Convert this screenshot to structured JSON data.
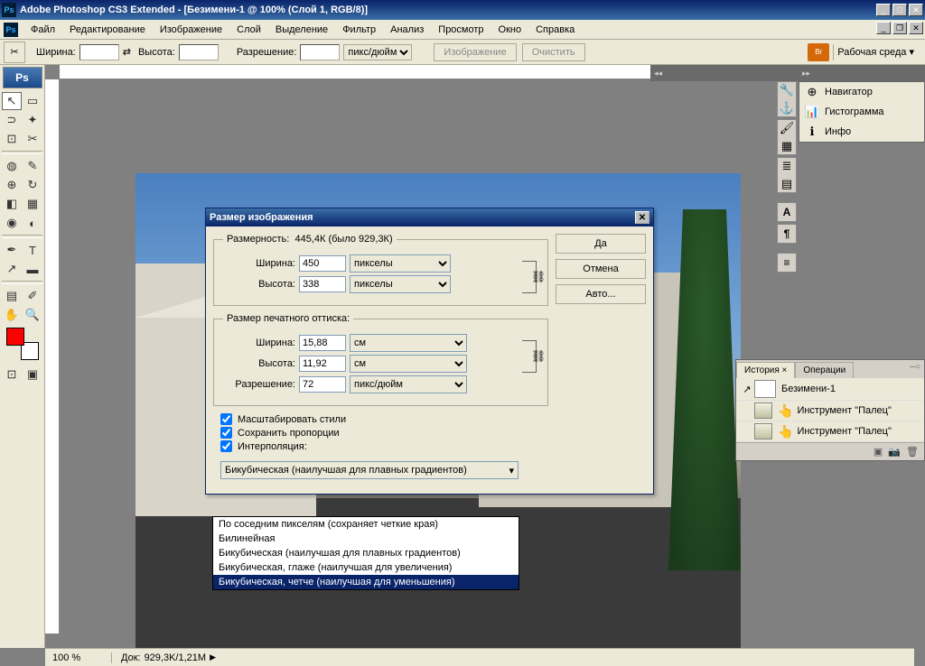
{
  "title": "Adobe Photoshop CS3 Extended - [Безимени-1 @ 100% (Слой 1, RGB/8)]",
  "menu": [
    "Файл",
    "Редактирование",
    "Изображение",
    "Слой",
    "Выделение",
    "Фильтр",
    "Анализ",
    "Просмотр",
    "Окно",
    "Справка"
  ],
  "optbar": {
    "width_label": "Ширина:",
    "width_val": "",
    "height_label": "Высота:",
    "height_val": "",
    "res_label": "Разрешение:",
    "res_val": "",
    "res_unit": "пикс/дюйм",
    "btn_image": "Изображение",
    "btn_clear": "Очистить",
    "workspace": "Рабочая среда ▾"
  },
  "toolbox_logo": "Ps",
  "fg_color": "#ff0000",
  "bg_color": "#ffffff",
  "panel_nav": {
    "items": [
      "Навигатор",
      "Гистограмма",
      "Инфо"
    ]
  },
  "history": {
    "tab1": "История ×",
    "tab2": "Операции",
    "doc": "Безимени-1",
    "step1": "Инструмент \"Палец\"",
    "step2": "Инструмент \"Палец\""
  },
  "status": {
    "zoom": "100 %",
    "doc_label": "Док:",
    "doc": "929,3K/1,21M"
  },
  "dialog": {
    "title": "Размер изображения",
    "dim_legend_pre": "Размерность:",
    "dim_legend_val": "445,4К (было 929,3К)",
    "width_l": "Ширина:",
    "width_v": "450",
    "height_l": "Высота:",
    "height_v": "338",
    "unit_px": "пикселы",
    "print_legend": "Размер печатного оттиска:",
    "pwidth_v": "15,88",
    "pheight_v": "11,92",
    "unit_cm": "см",
    "res_l": "Разрешение:",
    "res_v": "72",
    "res_unit": "пикс/дюйм",
    "chk1": "Масштабировать стили",
    "chk2": "Сохранить пропорции",
    "chk3": "Интерполяция:",
    "interp_sel": "Бикубическая (наилучшая для плавных градиентов)",
    "btn_ok": "Да",
    "btn_cancel": "Отмена",
    "btn_auto": "Авто..."
  },
  "dropdown": {
    "items": [
      "По соседним пикселям (сохраняет четкие края)",
      "Билинейная",
      "Бикубическая (наилучшая для плавных градиентов)",
      "Бикубическая, глаже (наилучшая для увеличения)",
      "Бикубическая, четче (наилучшая для уменьшения)"
    ],
    "selected_index": 4
  }
}
